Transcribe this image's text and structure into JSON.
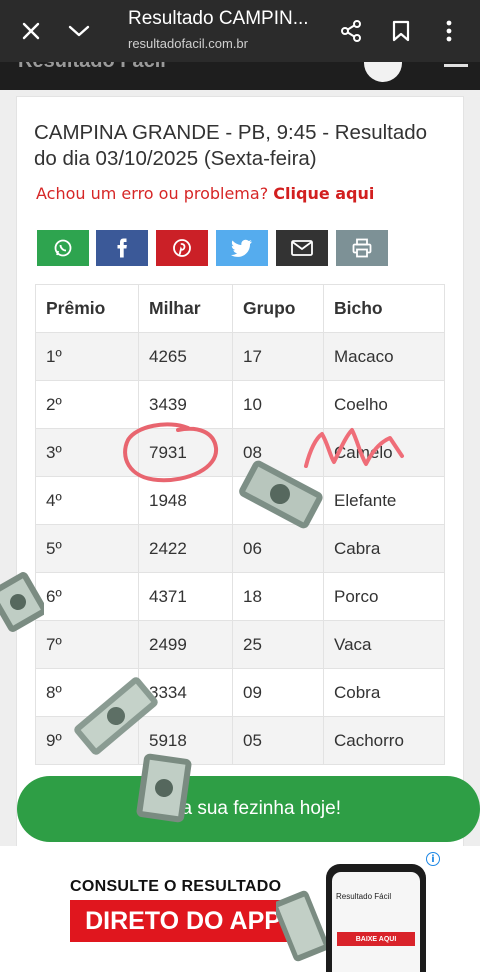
{
  "browser": {
    "title": "Resultado CAMPIN...",
    "url": "resultadofacil.com.br"
  },
  "site_header": {
    "ghost_text": "Resultado Fácil"
  },
  "result": {
    "title": "CAMPINA GRANDE - PB, 9:45 - Resultado do dia 03/10/2025 (Sexta-feira)",
    "error_prefix": "Achou um erro ou problema? ",
    "error_link": "Clique aqui"
  },
  "share": [
    {
      "icon": "whatsapp-icon",
      "color": "#2ea44f"
    },
    {
      "icon": "facebook-icon",
      "color": "#3b5998"
    },
    {
      "icon": "pinterest-icon",
      "color": "#cb2027"
    },
    {
      "icon": "twitter-icon",
      "color": "#55acee"
    },
    {
      "icon": "email-icon",
      "color": "#333333"
    },
    {
      "icon": "print-icon",
      "color": "#7d9196"
    }
  ],
  "table": {
    "headers": [
      "Prêmio",
      "Milhar",
      "Grupo",
      "Bicho"
    ],
    "rows": [
      [
        "1º",
        "4265",
        "17",
        "Macaco"
      ],
      [
        "2º",
        "3439",
        "10",
        "Coelho"
      ],
      [
        "3º",
        "7931",
        "08",
        "Camelo"
      ],
      [
        "4º",
        "1948",
        "",
        "Elefante"
      ],
      [
        "5º",
        "2422",
        "06",
        "Cabra"
      ],
      [
        "6º",
        "4371",
        "18",
        "Porco"
      ],
      [
        "7º",
        "2499",
        "25",
        "Vaca"
      ],
      [
        "8º",
        "3334",
        "09",
        "Cobra"
      ],
      [
        "9º",
        "5918",
        "05",
        "Cachorro"
      ]
    ]
  },
  "cta": {
    "label": "ça sua fezinha hoje!"
  },
  "ad": {
    "line1": "CONSULTE O RESULTADO",
    "line2": "DIRETO DO APP",
    "phone_app": "Resultado Fácil",
    "phone_button": "BAIXE AQUI"
  }
}
